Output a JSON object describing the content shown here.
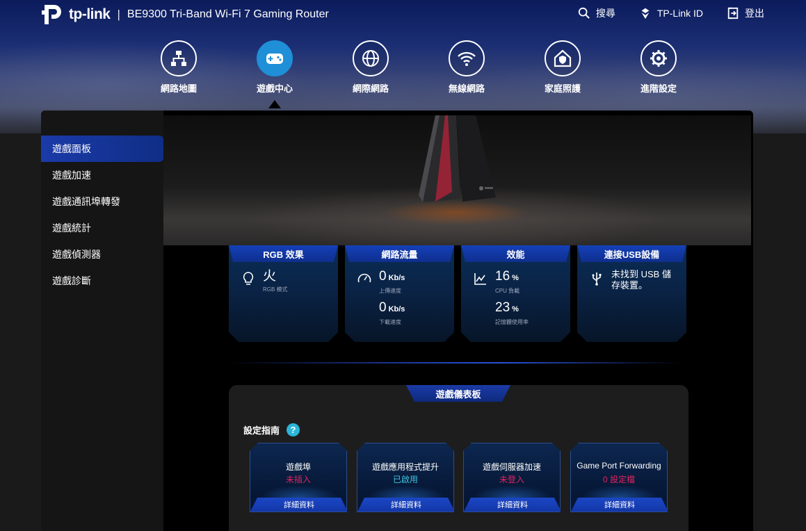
{
  "header": {
    "brand": "tp-link",
    "product": "BE9300 Tri-Band Wi-Fi 7 Gaming Router",
    "actions": [
      {
        "label": "搜尋",
        "icon": "search-icon"
      },
      {
        "label": "TP-Link ID",
        "icon": "tplink-id-icon"
      },
      {
        "label": "登出",
        "icon": "logout-icon"
      }
    ]
  },
  "nav": {
    "items": [
      {
        "label": "網路地圖",
        "icon": "network-map-icon"
      },
      {
        "label": "遊戲中心",
        "icon": "gamepad-icon",
        "active": true
      },
      {
        "label": "網際網路",
        "icon": "globe-icon"
      },
      {
        "label": "無線網路",
        "icon": "wifi-icon"
      },
      {
        "label": "家庭照護",
        "icon": "home-shield-icon"
      },
      {
        "label": "進階設定",
        "icon": "gear-icon"
      }
    ]
  },
  "sidebar": {
    "items": [
      {
        "label": "遊戲面板",
        "active": true
      },
      {
        "label": "遊戲加速"
      },
      {
        "label": "遊戲通訊埠轉發"
      },
      {
        "label": "遊戲統計"
      },
      {
        "label": "遊戲偵測器"
      },
      {
        "label": "遊戲診斷"
      }
    ]
  },
  "stats": {
    "rgb": {
      "title": "RGB 效果",
      "value": "火",
      "sub": "RGB 模式"
    },
    "traffic": {
      "title": "網路流量",
      "upload": {
        "value": "0",
        "unit": "Kb/s",
        "sub": "上傳速度"
      },
      "download": {
        "value": "0",
        "unit": "Kb/s",
        "sub": "下載速度"
      }
    },
    "performance": {
      "title": "效能",
      "cpu": {
        "value": "16",
        "unit": "%",
        "sub": "CPU 負載"
      },
      "memory": {
        "value": "23",
        "unit": "%",
        "sub": "記憶體使用率"
      }
    },
    "usb": {
      "title": "連接USB設備",
      "message_line1": "未找到 USB 儲",
      "message_line2": "存裝置。"
    }
  },
  "dashboard": {
    "title": "遊戲儀表板",
    "guide_label": "設定指南",
    "help": "?",
    "cards": [
      {
        "title": "遊戲埠",
        "status": "未插入",
        "status_color": "#e0245e",
        "button": "詳細資料"
      },
      {
        "title": "遊戲應用程式提升",
        "status": "已啟用",
        "status_color": "#3ec6e0",
        "button": "詳細資料"
      },
      {
        "title": "遊戲伺服器加速",
        "status": "未登入",
        "status_color": "#e0245e",
        "button": "詳細資料"
      },
      {
        "title": "Game Port Forwarding",
        "status": "0 設定檔",
        "status_color": "#e0245e",
        "button": "詳細資料"
      }
    ]
  },
  "colors": {
    "accent": "#1f8fd8",
    "alert": "#e0245e",
    "ok": "#3ec6e0"
  }
}
